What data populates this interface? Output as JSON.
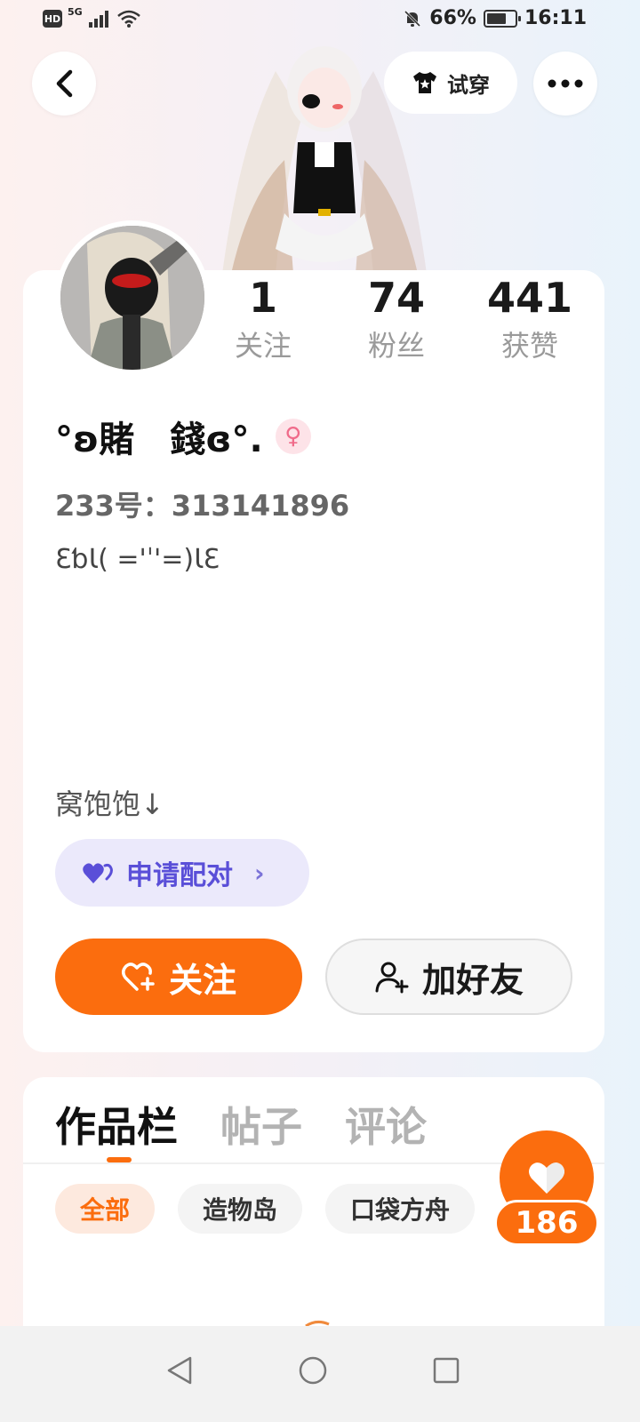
{
  "status_bar": {
    "hd": "HD",
    "network": "5G",
    "battery": "66%",
    "time": "16:11"
  },
  "header": {
    "tryon_label": "试穿"
  },
  "stats": [
    {
      "value": "1",
      "label": "关注"
    },
    {
      "value": "74",
      "label": "粉丝"
    },
    {
      "value": "441",
      "label": "获赞"
    }
  ],
  "profile": {
    "username": "°ʚ賭　錢ɞ°.",
    "gender_symbol": "♀",
    "uid": "233号：313141896",
    "bio": "ƐƅƖ( ='ˈ'=)ƖƐ",
    "signature": "窝饱饱↓"
  },
  "pair_button": {
    "label": "申请配对",
    "chevron": "›"
  },
  "actions": {
    "follow_label": "关注",
    "add_friend_label": "加好友"
  },
  "tabs": [
    "作品栏",
    "帖子",
    "评论"
  ],
  "chips": [
    "全部",
    "造物岛",
    "口袋方舟"
  ],
  "like_fab": {
    "count": "186"
  },
  "colors": {
    "accent": "#fb6d0e",
    "pair_bg": "#ebe9fb",
    "pair_text": "#5a4fd8"
  }
}
